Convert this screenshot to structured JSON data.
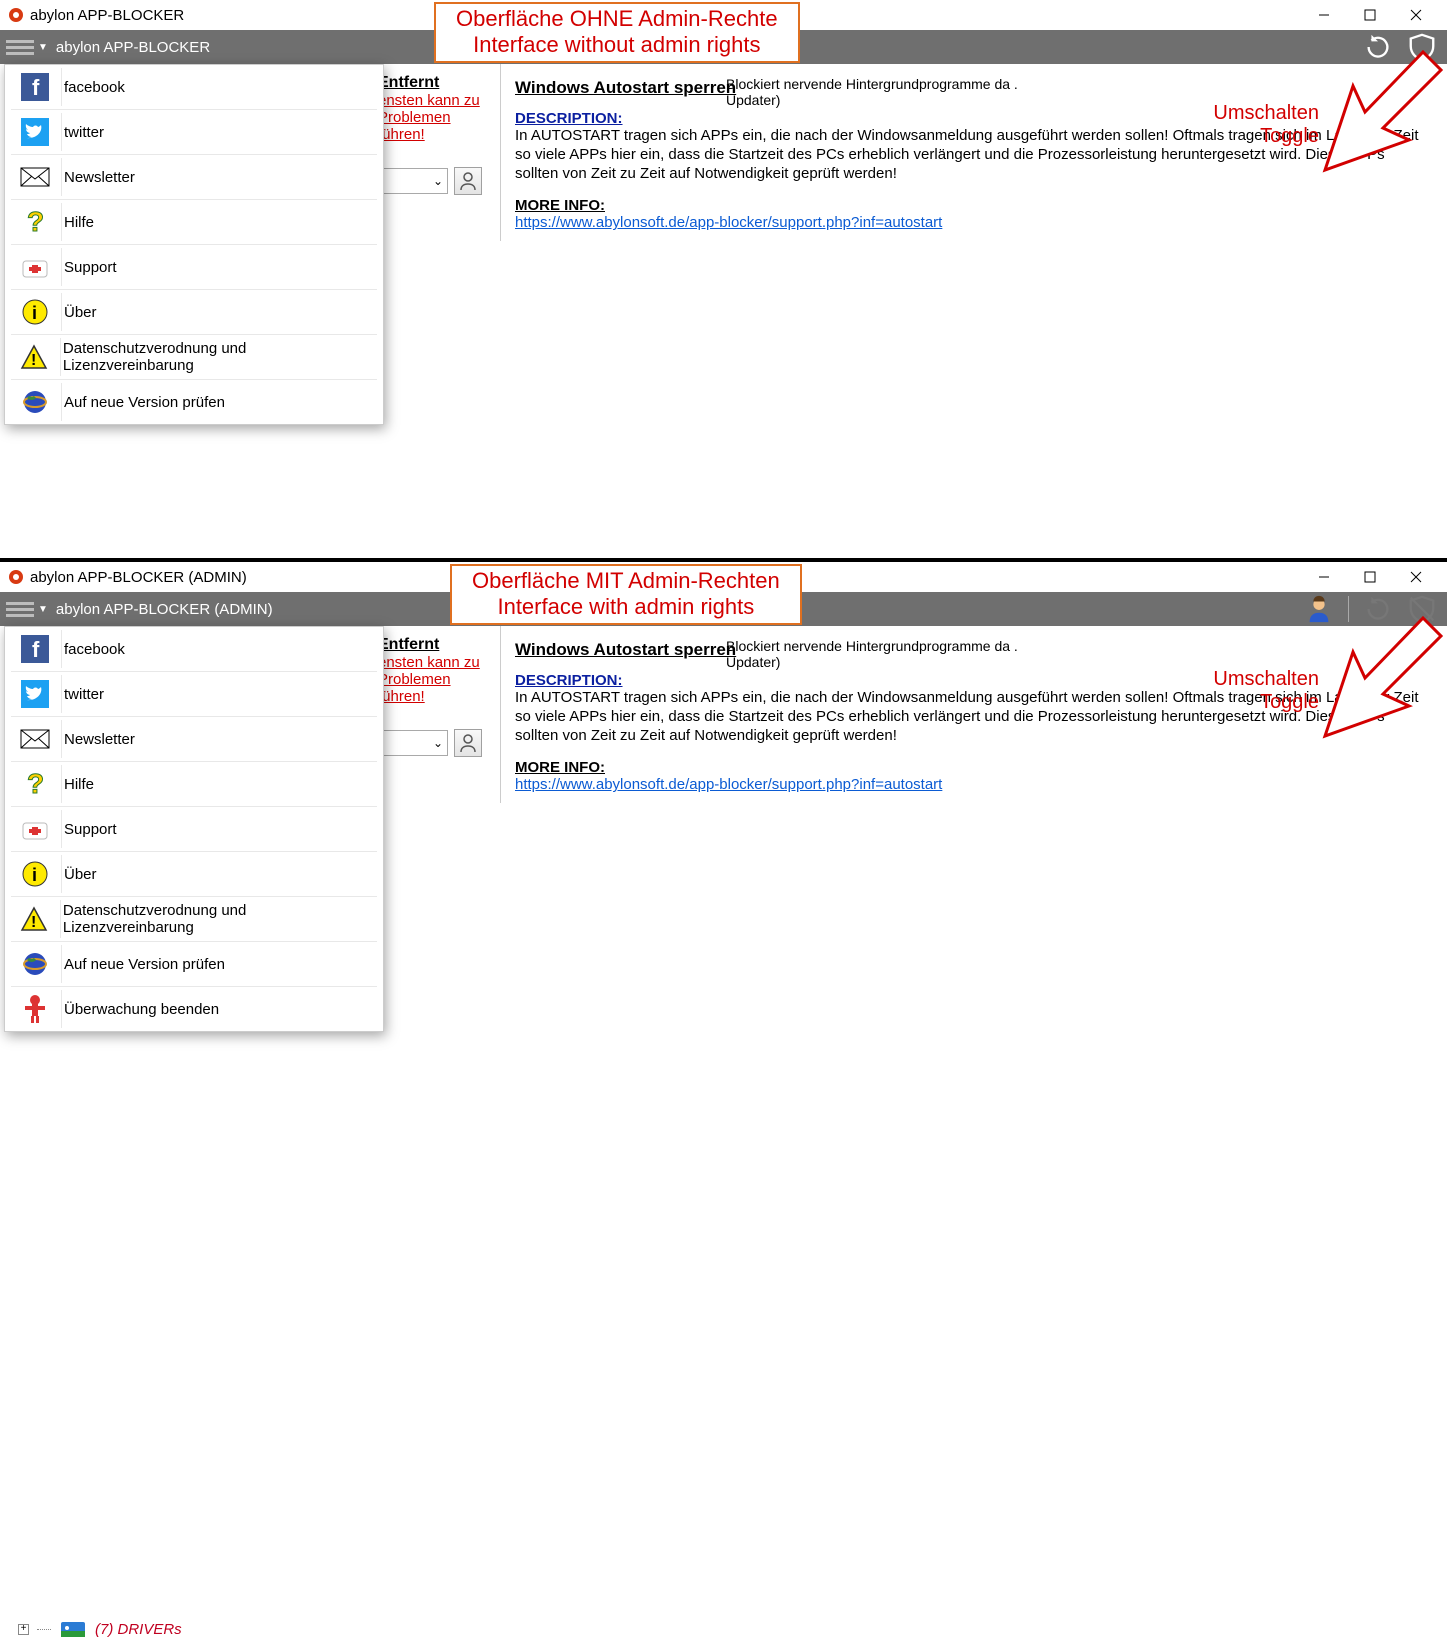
{
  "panel1": {
    "title": "abylon APP-BLOCKER",
    "greybar_title": "abylon APP-BLOCKER",
    "banner_line1": "Oberfläche OHNE Admin-Rechte",
    "banner_line2": "Interface without admin rights",
    "toggle_de": "Umschalten",
    "toggle_en": "Toggle",
    "entfernt": "Entfernt",
    "redwarn": "ensten kann zu Problemen führen!",
    "blockinfo": "Blockiert nervende Hintergrundprogramme da             . Updater)",
    "right_title": "Windows Autostart sperren",
    "desc_label": "DESCRIPTION:",
    "desc_text": "In AUTOSTART tragen sich APPs ein, die nach der Windowsanmeldung ausgeführt werden sollen! Oftmals tragen sich im Laufe der Zeit so viele APPs hier ein, dass die Startzeit des PCs erheblich verlängert und die Prozessorleistung heruntergesetzt wird. Diese APPs sollten von Zeit zu Zeit auf Notwendigkeit geprüft werden!",
    "more_label": "MORE INFO: ",
    "link": "https://www.abylonsoft.de/app-blocker/support.php?inf=autostart",
    "menu": [
      "facebook",
      "twitter",
      "Newsletter",
      "Hilfe",
      "Support",
      "Über",
      "Datenschutzverodnung und Lizenzvereinbarung",
      "Auf neue Version prüfen"
    ]
  },
  "panel2": {
    "title": "abylon APP-BLOCKER (ADMIN)",
    "greybar_title": "abylon APP-BLOCKER (ADMIN)",
    "banner_line1": "Oberfläche MIT Admin-Rechten",
    "banner_line2": "Interface with admin rights",
    "toggle_de": "Umschalten",
    "toggle_en": "Toggle",
    "entfernt": "Entfernt",
    "redwarn": "ensten kann zu Problemen führen!",
    "blockinfo": "Blockiert nervende Hintergrundprogramme da             . Updater)",
    "right_title": "Windows Autostart sperren",
    "desc_label": "DESCRIPTION:",
    "desc_text": "In AUTOSTART tragen sich APPs ein, die nach der Windowsanmeldung ausgeführt werden sollen! Oftmals tragen sich im Laufe der Zeit so viele APPs hier ein, dass die Startzeit des PCs erheblich verlängert und die Prozessorleistung heruntergesetzt wird. Diese APPs sollten von Zeit zu Zeit auf Notwendigkeit geprüft werden!",
    "more_label": "MORE INFO: ",
    "link": "https://www.abylonsoft.de/app-blocker/support.php?inf=autostart",
    "menu": [
      "facebook",
      "twitter",
      "Newsletter",
      "Hilfe",
      "Support",
      "Über",
      "Datenschutzverodnung und Lizenzvereinbarung",
      "Auf neue Version prüfen",
      "Überwachung beenden"
    ],
    "drivers": "(7) DRIVERs"
  }
}
